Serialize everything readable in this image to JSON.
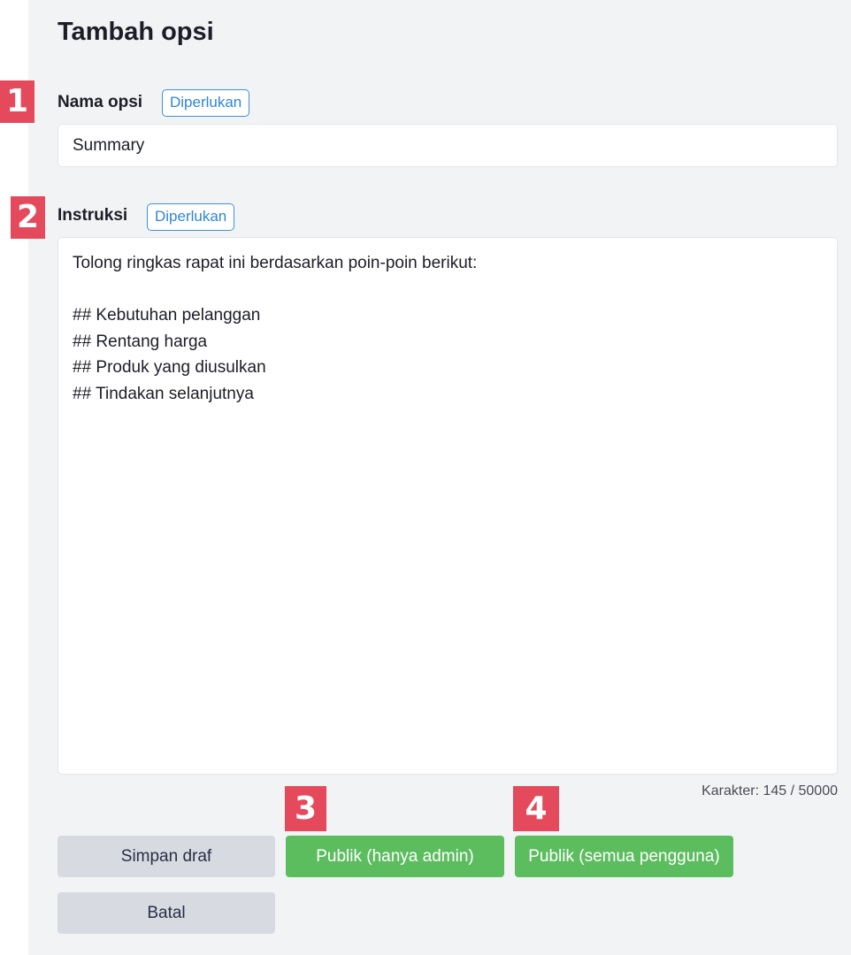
{
  "page": {
    "title": "Tambah opsi"
  },
  "markers": [
    "1",
    "2",
    "3",
    "4"
  ],
  "fields": {
    "name": {
      "label": "Nama opsi",
      "badge": "Diperlukan",
      "value": "Summary"
    },
    "instructions": {
      "label": "Instruksi",
      "badge": "Diperlukan",
      "lines": [
        "Tolong ringkas rapat ini berdasarkan poin-poin berikut:",
        "",
        "## Kebutuhan pelanggan",
        "## Rentang harga",
        "## Produk yang diusulkan",
        "## Tindakan selanjutnya"
      ]
    }
  },
  "counter": "Karakter: 145 / 50000",
  "buttons": {
    "save_draft": "Simpan draf",
    "publish_admin": "Publik (hanya admin)",
    "publish_all": "Publik (semua pengguna)",
    "cancel": "Batal"
  },
  "colors": {
    "marker": "#e5495c",
    "badge": "#2f86d8",
    "primary_button": "#5cbd5f",
    "secondary_button": "#d7dbe1",
    "panel_background": "#f2f3f5"
  }
}
